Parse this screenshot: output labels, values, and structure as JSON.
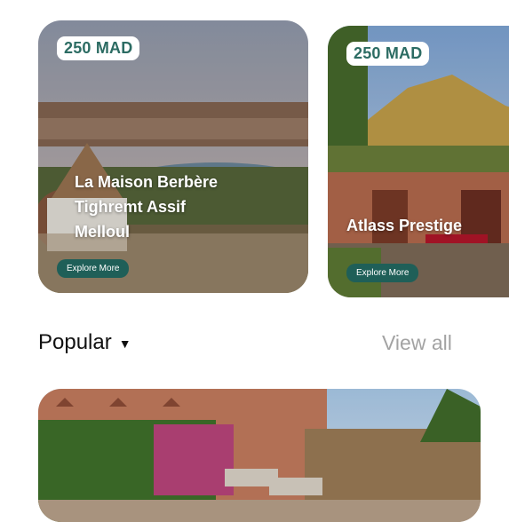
{
  "featured": [
    {
      "price": "250 MAD",
      "title_lines": [
        "La Maison Berbère",
        "Tighremt Assif",
        "Melloul"
      ],
      "button": "Explore More"
    },
    {
      "price": "250 MAD",
      "title_lines": [
        "Atlass Prestige"
      ],
      "button": "Explore More"
    }
  ],
  "section": {
    "title": "Popular",
    "view_all": "View all"
  }
}
